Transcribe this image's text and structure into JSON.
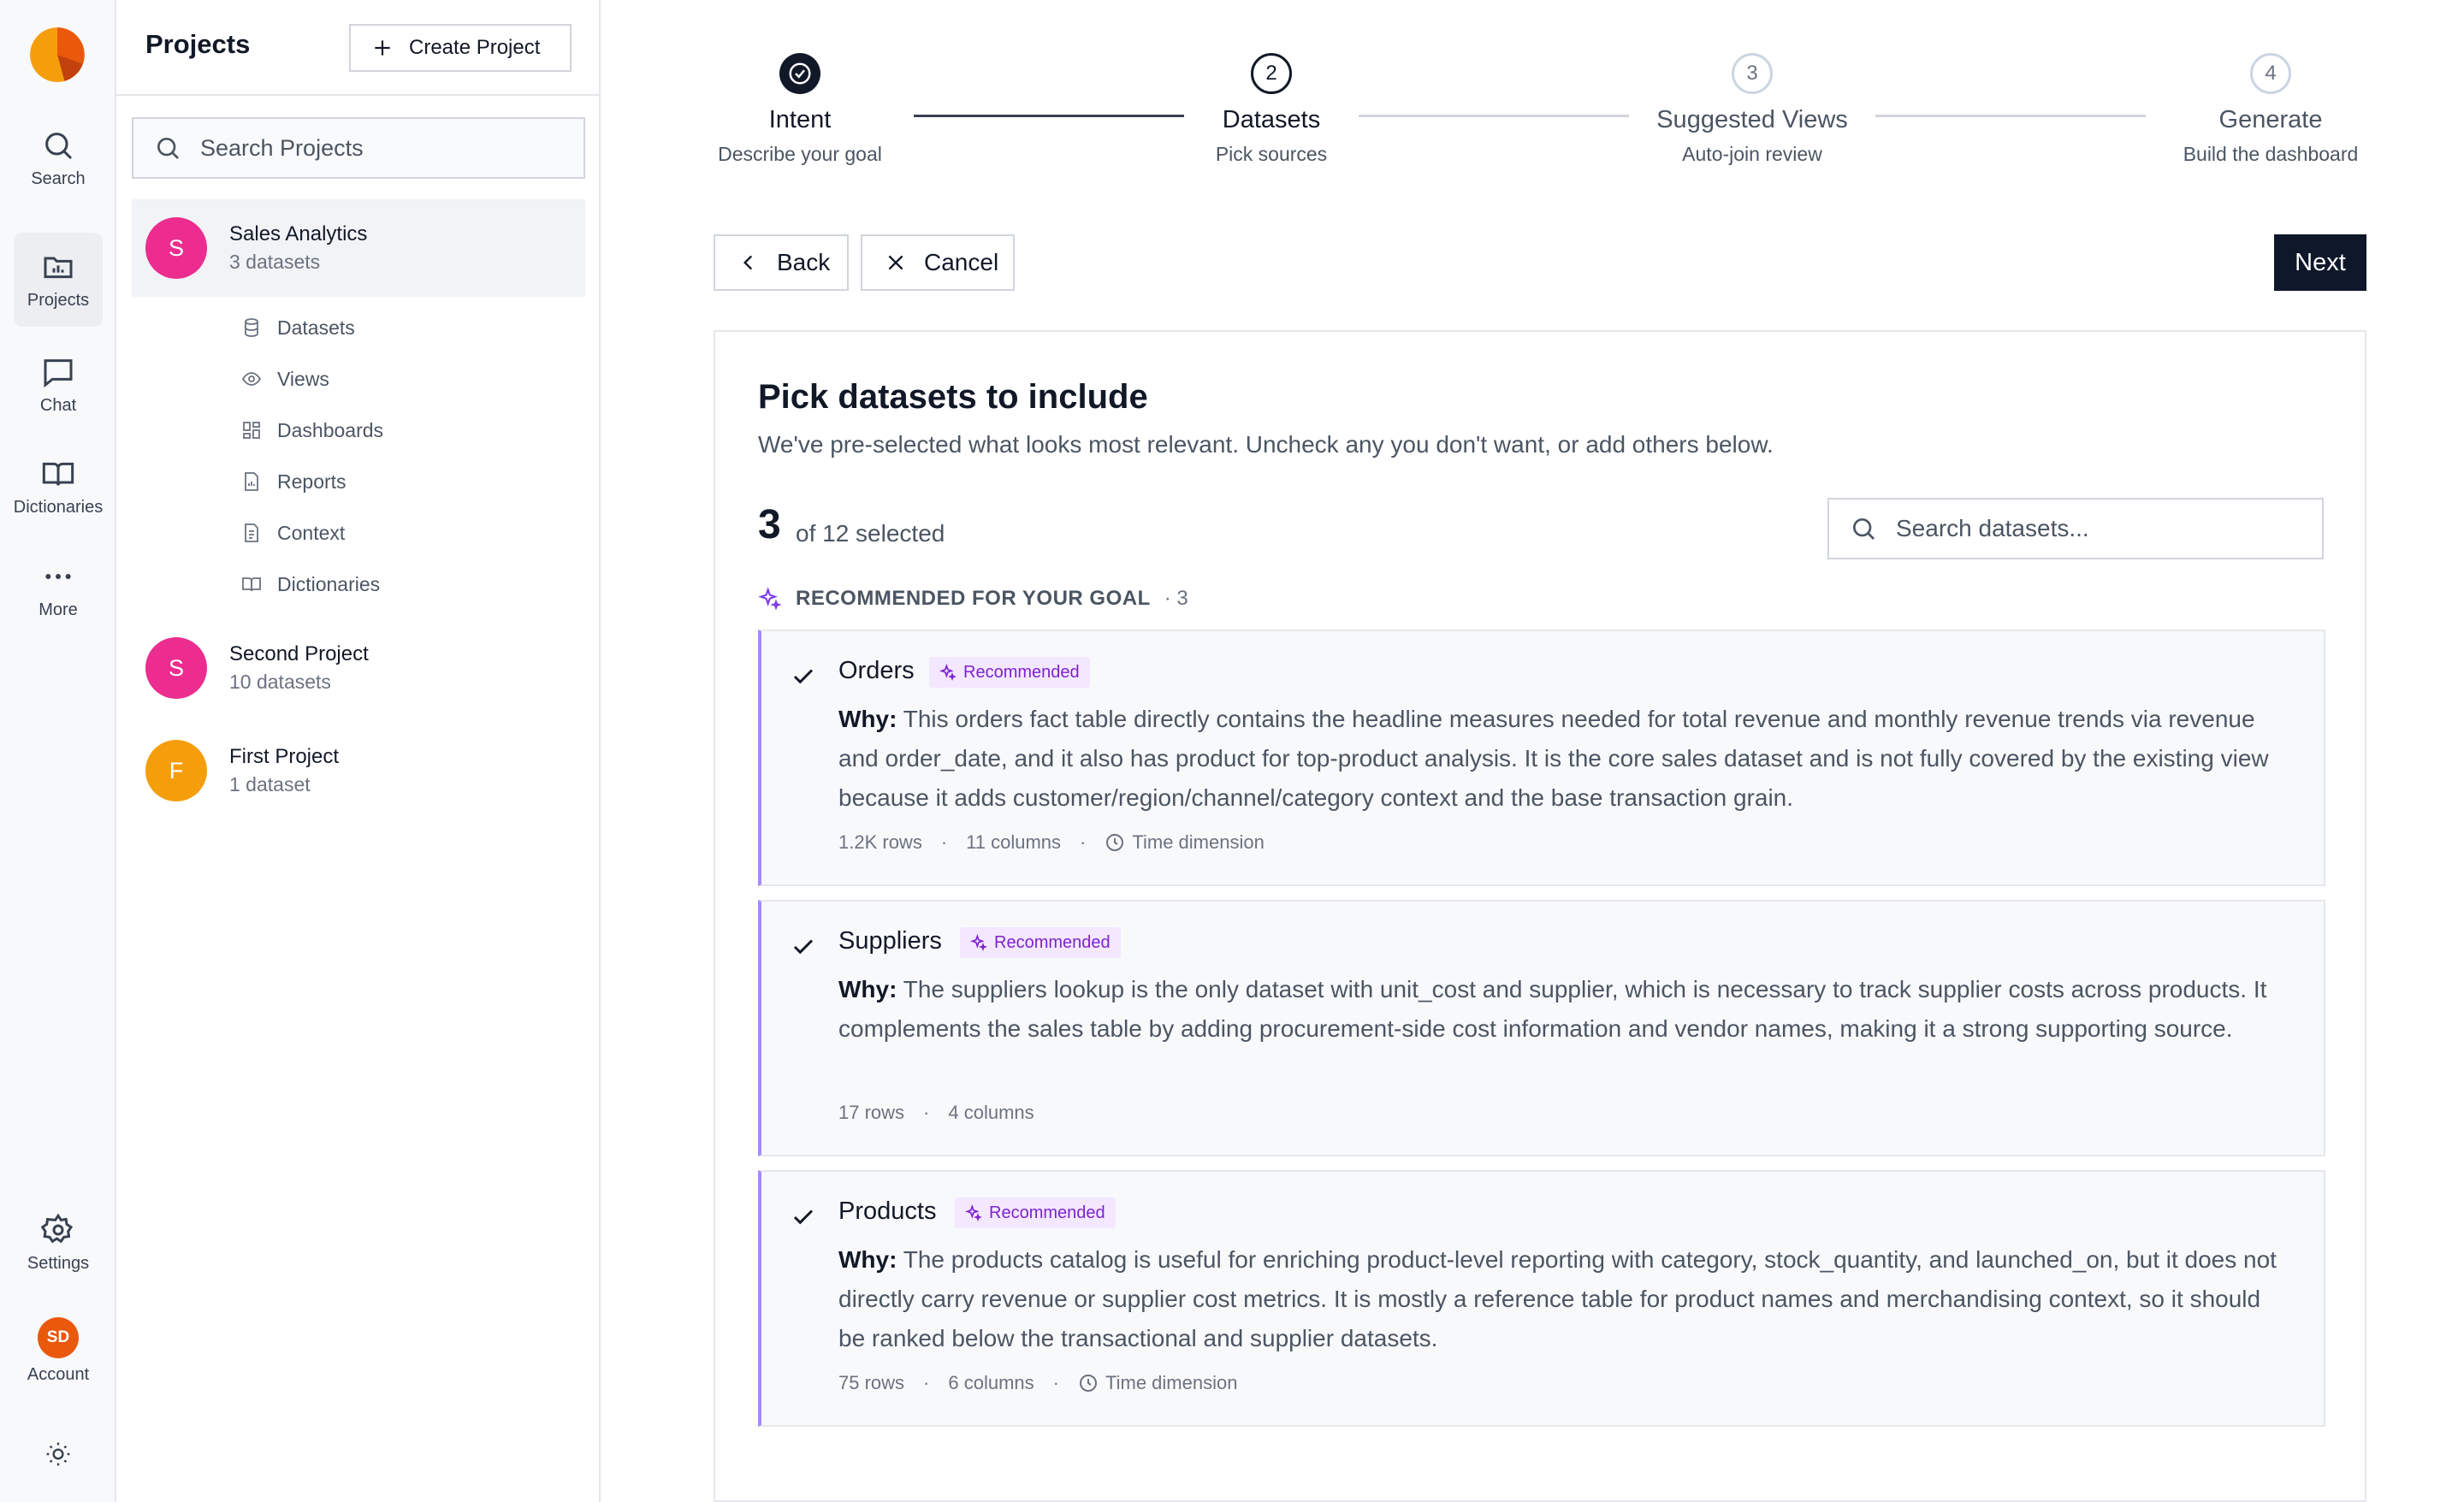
{
  "rail": {
    "items": [
      {
        "label": "Search"
      },
      {
        "label": "Projects"
      },
      {
        "label": "Chat"
      },
      {
        "label": "Dictionaries"
      },
      {
        "label": "More"
      }
    ],
    "settings_label": "Settings",
    "account_initials": "SD",
    "account_label": "Account"
  },
  "panel": {
    "title": "Projects",
    "create_label": "Create Project",
    "search_placeholder": "Search Projects",
    "projects": [
      {
        "initial": "S",
        "name": "Sales Analytics",
        "sub": "3 datasets",
        "color": "#ec2d8f"
      },
      {
        "initial": "S",
        "name": "Second Project",
        "sub": "10 datasets",
        "color": "#ec2d8f"
      },
      {
        "initial": "F",
        "name": "First Project",
        "sub": "1 dataset",
        "color": "#f59e0b"
      }
    ],
    "sub_items": [
      "Datasets",
      "Views",
      "Dashboards",
      "Reports",
      "Context",
      "Dictionaries"
    ]
  },
  "stepper": {
    "steps": [
      {
        "num": "1",
        "label": "Intent",
        "sub": "Describe your goal",
        "state": "done"
      },
      {
        "num": "2",
        "label": "Datasets",
        "sub": "Pick sources",
        "state": "current"
      },
      {
        "num": "3",
        "label": "Suggested Views",
        "sub": "Auto-join review",
        "state": "future"
      },
      {
        "num": "4",
        "label": "Generate",
        "sub": "Build the dashboard",
        "state": "future"
      }
    ]
  },
  "actions": {
    "back": "Back",
    "cancel": "Cancel",
    "next": "Next"
  },
  "card": {
    "title": "Pick datasets to include",
    "desc": "We've pre-selected what looks most relevant. Uncheck any you don't want, or add others below.",
    "selected_count": "3",
    "selected_of": "of 12 selected",
    "search_placeholder": "Search datasets...",
    "rec_label": "RECOMMENDED FOR YOUR GOAL",
    "rec_count": "· 3",
    "badge_label": "Recommended",
    "why_label": "Why:",
    "datasets": [
      {
        "name": "Orders",
        "checked": true,
        "why": "This orders fact table directly contains the headline measures needed for total revenue and monthly revenue trends via revenue and order_date, and it also has product for top-product analysis. It is the core sales dataset and is not fully covered by the existing view because it adds customer/region/channel/category context and the base transaction grain.",
        "rows": "1.2K rows",
        "columns": "11 columns",
        "time": "Time dimension"
      },
      {
        "name": "Suppliers",
        "checked": true,
        "why": "The suppliers lookup is the only dataset with unit_cost and supplier, which is necessary to track supplier costs across products. It complements the sales table by adding procurement-side cost information and vendor names, making it a strong supporting source.",
        "rows": "17 rows",
        "columns": "4 columns",
        "time": ""
      },
      {
        "name": "Products",
        "checked": true,
        "why": "The products catalog is useful for enriching product-level reporting with category, stock_quantity, and launched_on, but it does not directly carry revenue or supplier cost metrics. It is mostly a reference table for product names and merchandising context, so it should be ranked below the transactional and supplier datasets.",
        "rows": "75 rows",
        "columns": "6 columns",
        "time": "Time dimension"
      }
    ]
  },
  "colors": {
    "accent": "#0f172a",
    "recommended": "#7c3aed",
    "badge_bg": "#f3e8ff"
  }
}
